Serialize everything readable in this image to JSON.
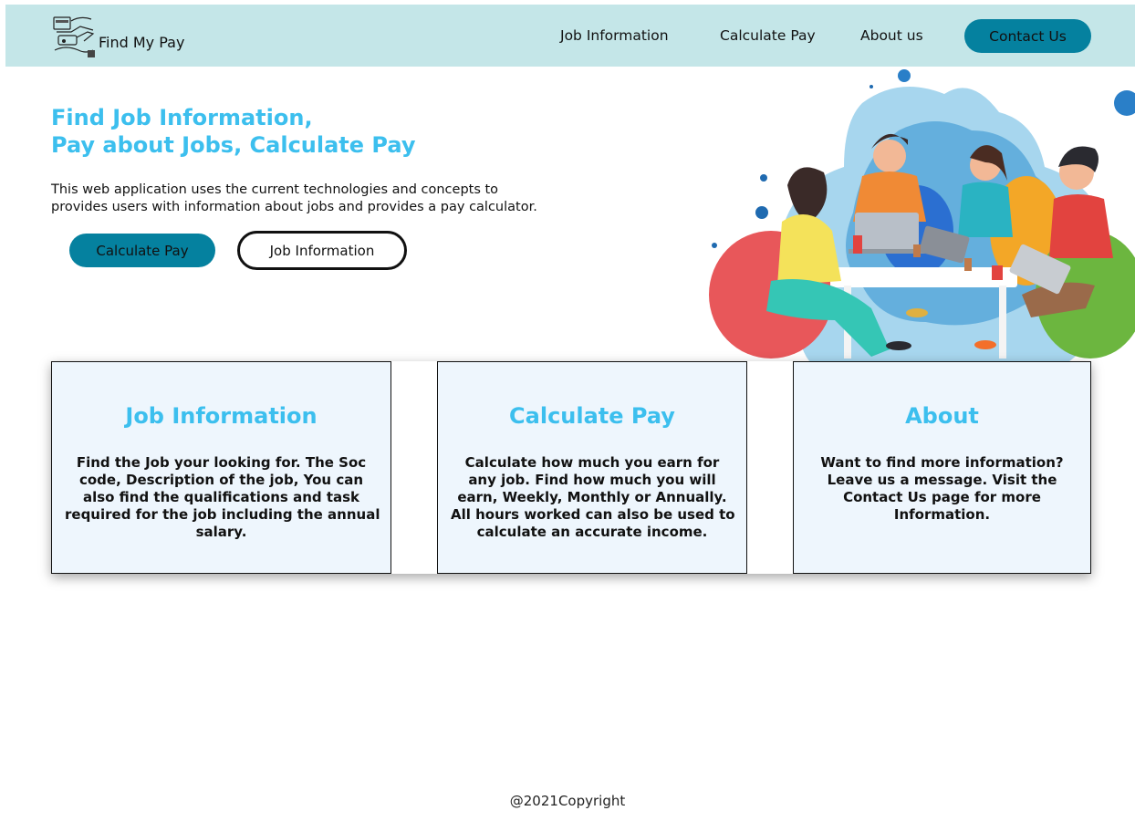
{
  "brand": {
    "name": "Find My Pay",
    "logo_icon": "pay-hands-logo-icon"
  },
  "nav": {
    "links": [
      "Job Information",
      "Calculate Pay",
      "About us"
    ],
    "contact": "Contact Us"
  },
  "hero": {
    "title_line1": "Find Job Information,",
    "title_line2": "Pay about Jobs, Calculate Pay",
    "desc_line1": "This web application uses the current technologies and concepts to",
    "desc_line2": "provides users with information about jobs and provides a pay calculator.",
    "primary_button": "Calculate Pay",
    "secondary_button": "Job Information",
    "illustration": "team-working-on-laptops-illustration"
  },
  "cards": [
    {
      "title": "Job Information",
      "lines": [
        "Find the Job your looking for. The Soc",
        "code, Description of the job, You can",
        "also find the qualifications and task",
        "required for the job including the annual",
        "salary."
      ]
    },
    {
      "title": "Calculate Pay",
      "lines": [
        "Calculate how much you earn for",
        "any job. Find how much you will",
        "earn, Weekly, Monthly or Annually.",
        "All hours worked can also be used to",
        "calculate an accurate income."
      ]
    },
    {
      "title": "About",
      "lines": [
        "Want to find more information?",
        "Leave us a message. Visit the",
        "Contact Us page for more",
        "Information."
      ]
    }
  ],
  "footer": {
    "copyright": "@2021Copyright"
  },
  "colors": {
    "navbar_bg": "#c4e6e8",
    "accent_button": "#05819f",
    "heading_blue": "#3cbfee",
    "card_bg": "#eef6fd"
  }
}
